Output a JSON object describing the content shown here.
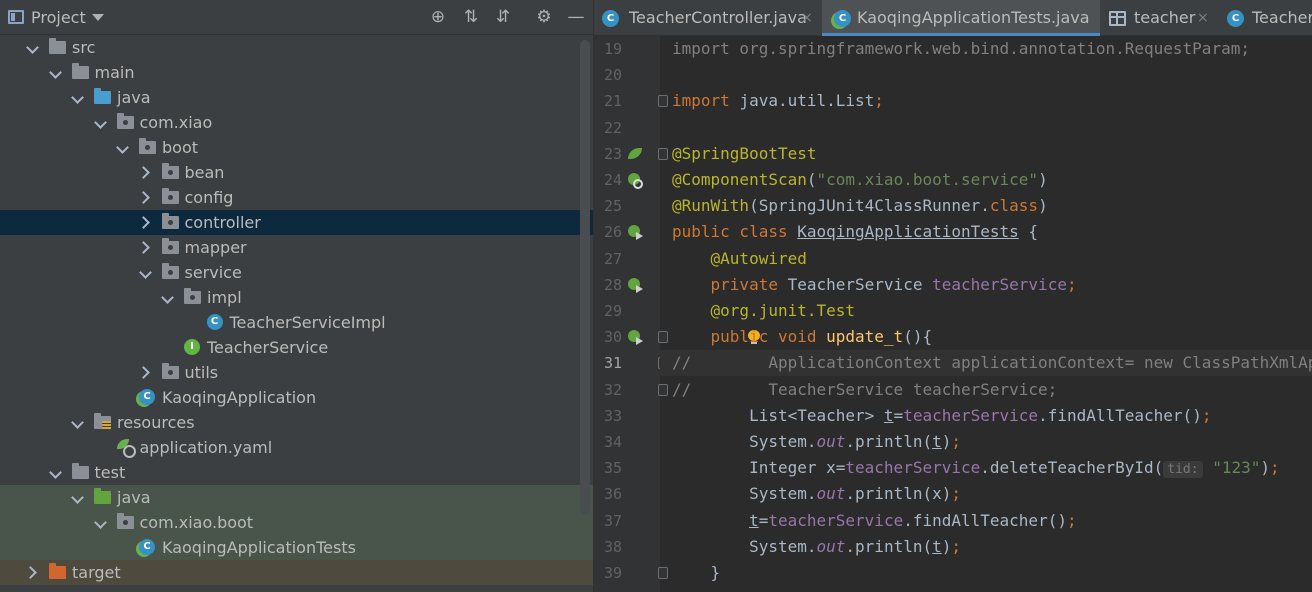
{
  "project_panel": {
    "title": "Project",
    "icons": [
      "locate-icon",
      "expand-all-icon",
      "collapse-all-icon",
      "gear-icon",
      "hide-icon"
    ]
  },
  "tree": [
    {
      "label": "src",
      "depth": 1,
      "expanded": true,
      "icon": "folder"
    },
    {
      "label": "main",
      "depth": 2,
      "expanded": true,
      "icon": "folder"
    },
    {
      "label": "java",
      "depth": 3,
      "expanded": true,
      "icon": "folder-blue"
    },
    {
      "label": "com.xiao",
      "depth": 4,
      "expanded": true,
      "icon": "package"
    },
    {
      "label": "boot",
      "depth": 5,
      "expanded": true,
      "icon": "package"
    },
    {
      "label": "bean",
      "depth": 6,
      "expanded": false,
      "icon": "package"
    },
    {
      "label": "config",
      "depth": 6,
      "expanded": false,
      "icon": "package"
    },
    {
      "label": "controller",
      "depth": 6,
      "expanded": false,
      "icon": "package",
      "selected": true
    },
    {
      "label": "mapper",
      "depth": 6,
      "expanded": false,
      "icon": "package"
    },
    {
      "label": "service",
      "depth": 6,
      "expanded": true,
      "icon": "package"
    },
    {
      "label": "impl",
      "depth": 7,
      "expanded": true,
      "icon": "package"
    },
    {
      "label": "TeacherServiceImpl",
      "depth": 8,
      "icon": "class"
    },
    {
      "label": "TeacherService",
      "depth": 7,
      "icon": "interface"
    },
    {
      "label": "utils",
      "depth": 6,
      "expanded": false,
      "icon": "package"
    },
    {
      "label": "KaoqingApplication",
      "depth": 5,
      "icon": "spring-class"
    },
    {
      "label": "resources",
      "depth": 3,
      "expanded": true,
      "icon": "folder-res"
    },
    {
      "label": "application.yaml",
      "depth": 4,
      "icon": "yaml"
    },
    {
      "label": "test",
      "depth": 2,
      "expanded": true,
      "icon": "folder"
    },
    {
      "label": "java",
      "depth": 3,
      "expanded": true,
      "icon": "folder-green",
      "test": true
    },
    {
      "label": "com.xiao.boot",
      "depth": 4,
      "expanded": true,
      "icon": "package",
      "test": true
    },
    {
      "label": "KaoqingApplicationTests",
      "depth": 5,
      "icon": "spring-class",
      "test": true
    },
    {
      "label": "target",
      "depth": 1,
      "expanded": false,
      "icon": "folder-orange",
      "excluded": true
    }
  ],
  "tabs": [
    {
      "label": "TeacherController.java",
      "icon": "class",
      "active": false
    },
    {
      "label": "KaoqingApplicationTests.java",
      "icon": "spring-class",
      "active": true
    },
    {
      "label": "teacher",
      "icon": "table",
      "active": false
    },
    {
      "label": "Teacher",
      "icon": "class",
      "active": false
    }
  ],
  "tab_close": "×",
  "current_line": 31,
  "editor_lines": [
    {
      "n": 19,
      "fold": false,
      "gutter": "",
      "parts": [
        [
          "cmt",
          "import org.springframework.web.bind.annotation.RequestParam;"
        ]
      ]
    },
    {
      "n": 20,
      "parts": []
    },
    {
      "n": 21,
      "fold": true,
      "parts": [
        [
          "kw",
          "import "
        ],
        [
          "",
          "java.util.List"
        ],
        [
          "kw",
          ";"
        ]
      ]
    },
    {
      "n": 22,
      "parts": []
    },
    {
      "n": 23,
      "fold": true,
      "gutter": "bean",
      "parts": [
        [
          "ann",
          "@SpringBootTest"
        ]
      ]
    },
    {
      "n": 24,
      "gutter": "find",
      "parts": [
        [
          "ann",
          "@ComponentScan"
        ],
        [
          "",
          "("
        ],
        [
          "str",
          "\"com.xiao.boot.service\""
        ],
        [
          "",
          ")"
        ]
      ]
    },
    {
      "n": 25,
      "parts": [
        [
          "ann",
          "@RunWith"
        ],
        [
          "",
          "(SpringJUnit4ClassRunner."
        ],
        [
          "kw",
          "class"
        ],
        [
          "",
          ")"
        ]
      ]
    },
    {
      "n": 26,
      "gutter": "run",
      "parts": [
        [
          "kw",
          "public class "
        ],
        [
          "und",
          "KaoqingApplicationTests"
        ],
        [
          "",
          " {"
        ]
      ]
    },
    {
      "n": 27,
      "parts": [
        [
          "",
          "    "
        ],
        [
          "ann",
          "@Autowired"
        ]
      ]
    },
    {
      "n": 28,
      "gutter": "find-run",
      "parts": [
        [
          "",
          "    "
        ],
        [
          "kw",
          "private "
        ],
        [
          "",
          "TeacherService "
        ],
        [
          "fld",
          "teacherService"
        ],
        [
          "kw",
          ";"
        ]
      ]
    },
    {
      "n": 29,
      "parts": [
        [
          "",
          "    "
        ],
        [
          "ann",
          "@org.junit.Test"
        ]
      ]
    },
    {
      "n": 30,
      "fold": true,
      "gutter": "run",
      "bulb": true,
      "parts": [
        [
          "",
          "    "
        ],
        [
          "kw",
          "public void "
        ],
        [
          "fn",
          "update_t"
        ],
        [
          "",
          "(){"
        ]
      ]
    },
    {
      "n": 31,
      "fold": true,
      "parts": [
        [
          "cmt",
          "//        ApplicationContext applicationContext= new ClassPathXmlApplicationContext"
        ]
      ]
    },
    {
      "n": 32,
      "fold": true,
      "parts": [
        [
          "cmt",
          "//        TeacherService teacherService;"
        ]
      ]
    },
    {
      "n": 33,
      "parts": [
        [
          "",
          "        List<Teacher> "
        ],
        [
          "und",
          "t"
        ],
        [
          "",
          "="
        ],
        [
          "fld",
          "teacherService"
        ],
        [
          "",
          ".findAllTeacher()"
        ],
        [
          "kw",
          ";"
        ]
      ]
    },
    {
      "n": 34,
      "parts": [
        [
          "",
          "        System."
        ],
        [
          "ital",
          "out"
        ],
        [
          "",
          ".println("
        ],
        [
          "und",
          "t"
        ],
        [
          "",
          ")"
        ],
        [
          "kw",
          ";"
        ]
      ]
    },
    {
      "n": 35,
      "parts": [
        [
          "",
          "        Integer x="
        ],
        [
          "fld",
          "teacherService"
        ],
        [
          "",
          ".deleteTeacherById("
        ],
        [
          "hint",
          "tid:"
        ],
        [
          "",
          " "
        ],
        [
          "str",
          "\"123\""
        ],
        [
          "",
          ")"
        ],
        [
          "kw",
          ";"
        ]
      ]
    },
    {
      "n": 36,
      "parts": [
        [
          "",
          "        System."
        ],
        [
          "ital",
          "out"
        ],
        [
          "",
          ".println(x)"
        ],
        [
          "kw",
          ";"
        ]
      ]
    },
    {
      "n": 37,
      "parts": [
        [
          "",
          "        "
        ],
        [
          "und",
          "t"
        ],
        [
          "",
          "="
        ],
        [
          "fld",
          "teacherService"
        ],
        [
          "",
          ".findAllTeacher()"
        ],
        [
          "kw",
          ";"
        ]
      ]
    },
    {
      "n": 38,
      "parts": [
        [
          "",
          "        System."
        ],
        [
          "ital",
          "out"
        ],
        [
          "",
          ".println("
        ],
        [
          "und",
          "t"
        ],
        [
          "",
          ")"
        ],
        [
          "kw",
          ";"
        ]
      ]
    },
    {
      "n": 39,
      "fold": true,
      "parts": [
        [
          "",
          "    }"
        ]
      ]
    }
  ]
}
